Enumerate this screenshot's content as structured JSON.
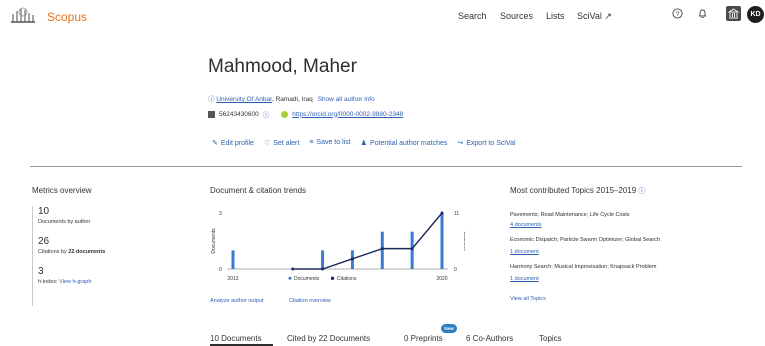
{
  "header": {
    "brand": "Scopus",
    "nav": [
      "Search",
      "Sources",
      "Lists",
      "SciVal ↗"
    ],
    "avatar_initials": "KD"
  },
  "author": {
    "name": "Mahmood, Maher",
    "affiliation": "University Of Anbar",
    "location": ", Ramadi, Iraq",
    "show_all": "Show all author info",
    "scopus_id": "56243430600",
    "orcid": "https://orcid.org/0000-0002-9880-2348"
  },
  "actions": [
    "Edit profile",
    "Set alert",
    "Save to list",
    "Potential author matches",
    "Export to SciVal"
  ],
  "metrics": {
    "title": "Metrics overview",
    "documents_value": "10",
    "documents_label": "Documents by author",
    "citations_value": "26",
    "citations_label_prefix": "Citations by ",
    "citations_label_bold": "22 documents",
    "hindex_value": "3",
    "hindex_label": "h-index:",
    "hindex_link": "View h-graph"
  },
  "chart": {
    "title": "Document & citation trends",
    "links": [
      "Analyze author output",
      "Citation overview"
    ]
  },
  "chart_data": {
    "type": "bar",
    "x": [
      2013,
      2014,
      2015,
      2016,
      2017,
      2018,
      2019,
      2020
    ],
    "series": [
      {
        "name": "Documents",
        "kind": "bar",
        "values": [
          1,
          0,
          0,
          1,
          1,
          2,
          2,
          3
        ]
      },
      {
        "name": "Citations",
        "kind": "line",
        "values": [
          null,
          null,
          0,
          0,
          2,
          4,
          4,
          11
        ]
      }
    ],
    "x_tick_labels": [
      "2013",
      "2020"
    ],
    "y_left_label": "Documents",
    "y_left_ticks": [
      "0",
      "3"
    ],
    "y_right_label": "Citations",
    "y_right_ticks": [
      "0",
      "11"
    ],
    "ylim_left": [
      0,
      3
    ],
    "ylim_right": [
      0,
      11
    ],
    "legend": [
      "Documents",
      "Citations"
    ],
    "legend_position": "bottom",
    "colors": {
      "documents": "#3a7bd5",
      "citations": "#1f2a5c"
    }
  },
  "topics": {
    "title": "Most contributed Topics 2015–2019",
    "items": [
      {
        "name": "Pavements; Road Maintenance; Life Cycle Costs",
        "count": "4 documents"
      },
      {
        "name": "Economic Dispatch; Particle Swarm Optimizer; Global Search",
        "count": "1 document"
      },
      {
        "name": "Harmony Search; Musical Improvisation; Knapsack Problem",
        "count": "1 document"
      }
    ],
    "view_all": "View all Topics"
  },
  "tabs": [
    "10 Documents",
    "Cited by 22 Documents",
    "0 Preprints",
    "6 Co-Authors",
    "Topics"
  ],
  "new_badge": "New"
}
